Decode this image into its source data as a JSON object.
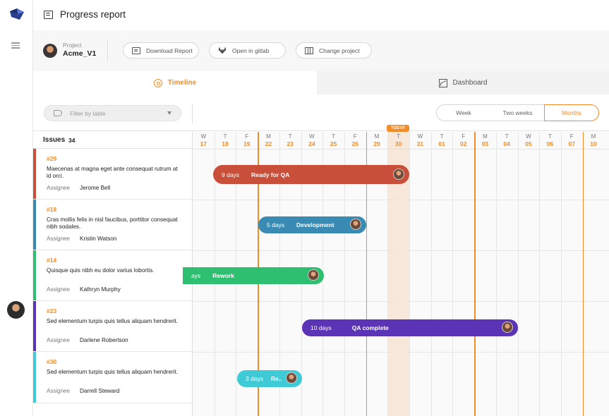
{
  "header": {
    "title": "Progress report"
  },
  "project": {
    "label": "Project",
    "name": "Acme_V1"
  },
  "toolbar": {
    "download_label": "Download Report",
    "gitlab_label": "Open in gitlab",
    "change_label": "Change project"
  },
  "tabs": [
    {
      "label": "Timeline",
      "active": true
    },
    {
      "label": "Dashboard",
      "active": false
    }
  ],
  "filter": {
    "placeholder": "Filter by lable"
  },
  "range": {
    "options": [
      "Week",
      "Two weeks",
      "Months"
    ],
    "selected": "Months"
  },
  "issues": {
    "title": "Issues",
    "count": "34",
    "assignee_label": "Assignee",
    "items": [
      {
        "id": "#29",
        "text": "Maecenas at magna eget ante consequat rutrum at id orci.",
        "assignee": "Jerome Bell",
        "color": "#c8503a"
      },
      {
        "id": "#18",
        "text": "Cras mollis felis in nisl faucibus, porttitor consequat nibh sodales.",
        "assignee": "Kristin Watson",
        "color": "#3a8bb3"
      },
      {
        "id": "#14",
        "text": "Quisque quis nibh eu dolor varius lobortis.",
        "assignee": "Kathryn Murphy",
        "color": "#2fbf71"
      },
      {
        "id": "#23",
        "text": "Sed elementum turpis quis tellus aliquam hendrerit.",
        "assignee": "Darlene Robertson",
        "color": "#5b34b6"
      },
      {
        "id": "#30",
        "text": "Sed elementum turpis quis tellus aliquam hendrerit.",
        "assignee": "Darrell Steward",
        "color": "#3fcbd6"
      }
    ]
  },
  "timeline": {
    "today_label": "TODAY",
    "days": [
      {
        "dow": "W",
        "day": "17"
      },
      {
        "dow": "T",
        "day": "18"
      },
      {
        "dow": "F",
        "day": "19"
      },
      {
        "dow": "M",
        "day": "22"
      },
      {
        "dow": "T",
        "day": "23"
      },
      {
        "dow": "W",
        "day": "24"
      },
      {
        "dow": "T",
        "day": "25"
      },
      {
        "dow": "F",
        "day": "26"
      },
      {
        "dow": "M",
        "day": "29"
      },
      {
        "dow": "T",
        "day": "30"
      },
      {
        "dow": "W",
        "day": "31"
      },
      {
        "dow": "T",
        "day": "01"
      },
      {
        "dow": "F",
        "day": "02"
      },
      {
        "dow": "M",
        "day": "03"
      },
      {
        "dow": "T",
        "day": "04"
      },
      {
        "dow": "W",
        "day": "05"
      },
      {
        "dow": "T",
        "day": "06"
      },
      {
        "dow": "F",
        "day": "07"
      },
      {
        "dow": "M",
        "day": "10"
      }
    ],
    "bars": [
      {
        "days": "9 days",
        "status": "Ready for QA",
        "color": "#c8503a"
      },
      {
        "days": "5 days",
        "status": "Development",
        "color": "#3a8bb3"
      },
      {
        "days": "ays",
        "status": "Rework",
        "color": "#2fbf71"
      },
      {
        "days": "10 days",
        "status": "QA complete",
        "color": "#5b34b6"
      },
      {
        "days": "3 days",
        "status": "Re..",
        "color": "#3fcbd6"
      }
    ]
  }
}
